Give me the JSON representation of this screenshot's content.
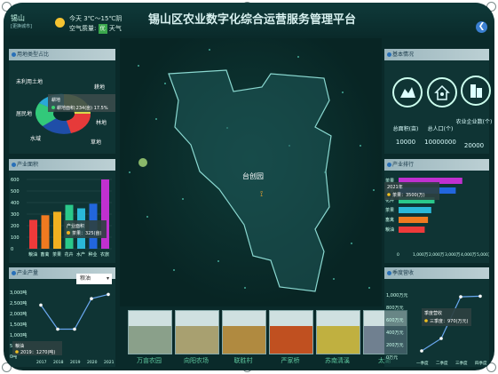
{
  "header": {
    "title": "锡山区农业数字化综合运营服务管理平台",
    "location": "锡山",
    "location_sub": "[更换城市]",
    "weather_line": "今天 3℃～15℃阴",
    "air_label": "空气质量:",
    "air_value": "优",
    "weather_word": "天气"
  },
  "panels": {
    "land": "用地类型占比",
    "industry": "产业面积",
    "output": "产业产量",
    "basic": "基本情况",
    "ranking": "产业排行",
    "quarter": "季度营收"
  },
  "land_chart": {
    "labels": [
      "未利用土地",
      "耕地",
      "居民地",
      "林地",
      "水域",
      "草地"
    ],
    "tooltip_title": "耕地",
    "tooltip_value": "耕地面积:234(亩) 17.5%",
    "colors": [
      "#29a9d8",
      "#e63a3a",
      "#6b6b6b",
      "#32c97a",
      "#1f4ea8",
      "#d9d94a"
    ]
  },
  "industry_chart": {
    "type": "bar",
    "categories": [
      "粮油",
      "畜禽",
      "茶果",
      "花卉",
      "水产",
      "种业",
      "农旅"
    ],
    "values": [
      250,
      290,
      320,
      380,
      350,
      390,
      600
    ],
    "colors": [
      "#ee3a3a",
      "#f07a20",
      "#f0b020",
      "#2ac88a",
      "#2ab8d8",
      "#2266dd",
      "#c030d0"
    ],
    "yticks": [
      "600",
      "500",
      "400",
      "300",
      "200",
      "100",
      "0"
    ],
    "tooltip_title": "产业面积",
    "tooltip_value": "茶果：325(亩)",
    "ylim": [
      0,
      600
    ]
  },
  "output_chart": {
    "type": "line",
    "select": "粮油",
    "x": [
      "2017",
      "2018",
      "2019",
      "2020",
      "2021"
    ],
    "values": [
      2400,
      1270,
      1270,
      2700,
      2900
    ],
    "yticks": [
      "3,000吨",
      "2,500吨",
      "2,000吨",
      "1,500吨",
      "1,000吨",
      "500吨",
      "0吨"
    ],
    "tooltip_title": "粮油",
    "tooltip_value": "2019：1270(吨)",
    "ylim": [
      0,
      3000
    ]
  },
  "basic": {
    "items": [
      {
        "label": "总面积(亩)",
        "value": "10000"
      },
      {
        "label": "总人口(个)",
        "value": "10000000"
      },
      {
        "label": "农业企业数(个)",
        "value": "20000"
      }
    ]
  },
  "ranking_chart": {
    "type": "bar",
    "categories": [
      "茶果",
      "茶果",
      "花卉",
      "茶果",
      "畜禽",
      "粮油"
    ],
    "values": [
      3900,
      3500,
      2200,
      2000,
      1800,
      1600
    ],
    "colors": [
      "#c030d0",
      "#2266dd",
      "#2ac88a",
      "#2ab8d8",
      "#f07a20",
      "#ee3a3a"
    ],
    "tooltip_title": "2021年",
    "tooltip_value": "茶果：3500(万)",
    "xticks": [
      "0",
      "1,000万",
      "2,000万",
      "3,000万",
      "4,000万",
      "5,000万"
    ]
  },
  "quarter_chart": {
    "type": "line",
    "x": [
      "一季度",
      "二季度",
      "三季度",
      "四季度"
    ],
    "values": [
      100,
      300,
      970,
      980
    ],
    "yticks": [
      "1,000万元",
      "800万元",
      "600万元",
      "400万元",
      "200万元",
      "0万元"
    ],
    "tooltip_title": "季度营收",
    "tooltip_value": "三季度：970(万元)",
    "ylim": [
      0,
      1000
    ]
  },
  "map": {
    "label": "台创园"
  },
  "thumbs": [
    {
      "label": "万亩农园",
      "c": "#8aa08a"
    },
    {
      "label": "向阳农场",
      "c": "#a8a070"
    },
    {
      "label": "联胜村",
      "c": "#b08a40"
    },
    {
      "label": "严家桥",
      "c": "#c05020"
    },
    {
      "label": "苏南清溪",
      "c": "#c0b040"
    },
    {
      "label": "太湖",
      "c": "#708090"
    }
  ]
}
